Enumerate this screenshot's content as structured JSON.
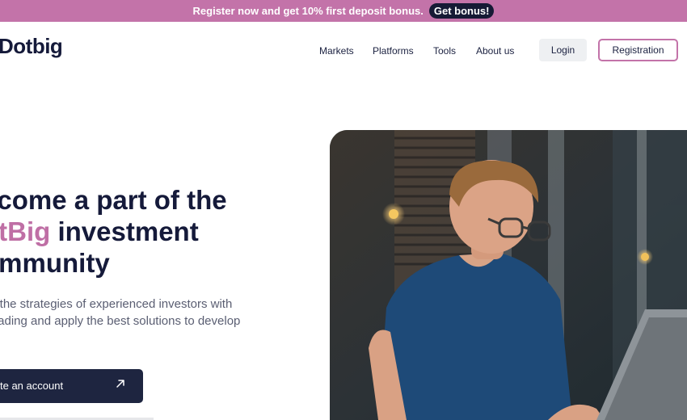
{
  "promo": {
    "text": "Register now and get 10% first deposit bonus.",
    "button_label": "Get bonus!"
  },
  "header": {
    "logo": "Dotbig",
    "nav": [
      "Markets",
      "Platforms",
      "Tools",
      "About us"
    ],
    "login_label": "Login",
    "registration_label": "Registration"
  },
  "hero": {
    "title_line1": "ecome a part of the",
    "title_accent": "otBig",
    "title_line2_rest": " investment",
    "title_line3": "ommunity",
    "subtitle_line1": "y the strategies of experienced investors with",
    "subtitle_line2": " trading and apply the best solutions to develop",
    "subtitle_line3": ".",
    "cta_label": "te an account",
    "cta_icon": "arrow-up-right-icon"
  },
  "colors": {
    "brand_pink": "#c373a9",
    "dark_navy": "#1e2540",
    "text_dark": "#151a3a"
  }
}
